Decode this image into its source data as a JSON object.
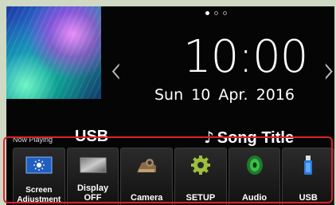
{
  "home": {
    "time": "10:00",
    "date": "Sun 10 Apr. 2016",
    "now_playing_label": "Now Playing",
    "source": "USB",
    "song_note": "♪",
    "song_title": "Song Title",
    "prev_glyph": "‹",
    "next_glyph": "›",
    "page_indicator": {
      "pages": 3,
      "current": 1
    }
  },
  "shortcuts": [
    {
      "label_line1": "Screen",
      "label_line2": "Adjustment",
      "icon": "screen-adjustment-icon"
    },
    {
      "label": "Display OFF",
      "icon": "display-off-icon"
    },
    {
      "label": "Camera",
      "icon": "camera-icon"
    },
    {
      "label": "SETUP",
      "icon": "gear-icon"
    },
    {
      "label": "Audio",
      "icon": "speaker-icon"
    },
    {
      "label": "USB",
      "icon": "usb-icon"
    }
  ],
  "colors": {
    "highlight": "#e0202a",
    "background": "#cfd9c4"
  }
}
